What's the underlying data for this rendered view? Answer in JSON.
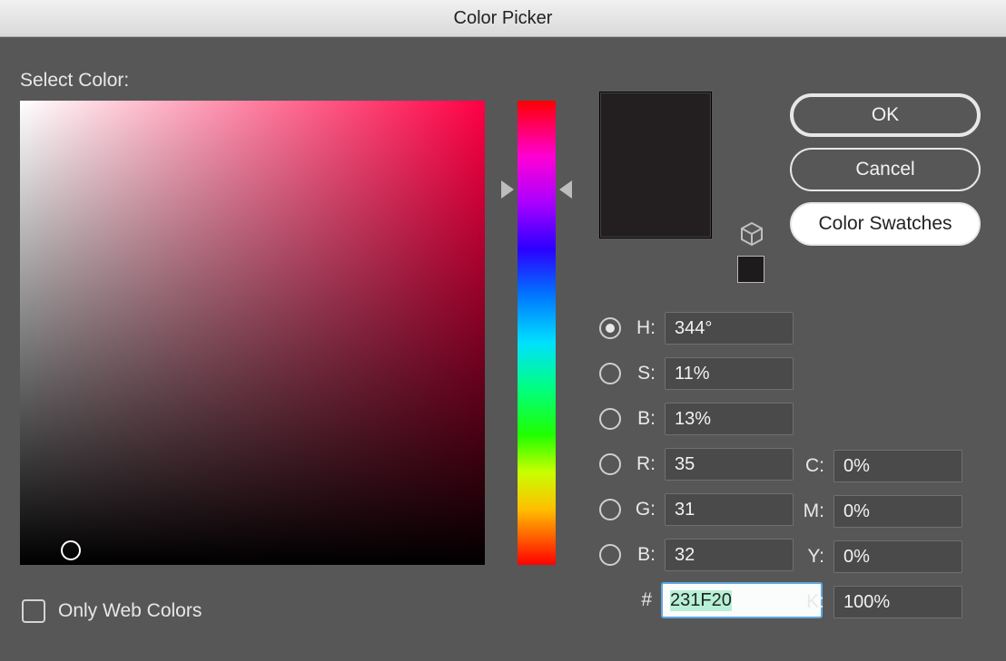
{
  "window": {
    "title": "Color Picker"
  },
  "heading": "Select Color:",
  "buttons": {
    "ok": "OK",
    "cancel": "Cancel",
    "swatches": "Color Swatches"
  },
  "fields": {
    "h": {
      "label": "H:",
      "value": "344°"
    },
    "s": {
      "label": "S:",
      "value": "11%"
    },
    "b": {
      "label": "B:",
      "value": "13%"
    },
    "r": {
      "label": "R:",
      "value": "35"
    },
    "g": {
      "label": "G:",
      "value": "31"
    },
    "bl": {
      "label": "B:",
      "value": "32"
    },
    "hexlabel": "#",
    "hex": "231F20"
  },
  "cmyk": {
    "c": {
      "label": "C:",
      "value": "0%"
    },
    "m": {
      "label": "M:",
      "value": "0%"
    },
    "y": {
      "label": "Y:",
      "value": "0%"
    },
    "k": {
      "label": "K:",
      "value": "100%"
    }
  },
  "webcolors": "Only Web Colors",
  "selected_color": "#231F20",
  "hue_degrees": 344
}
